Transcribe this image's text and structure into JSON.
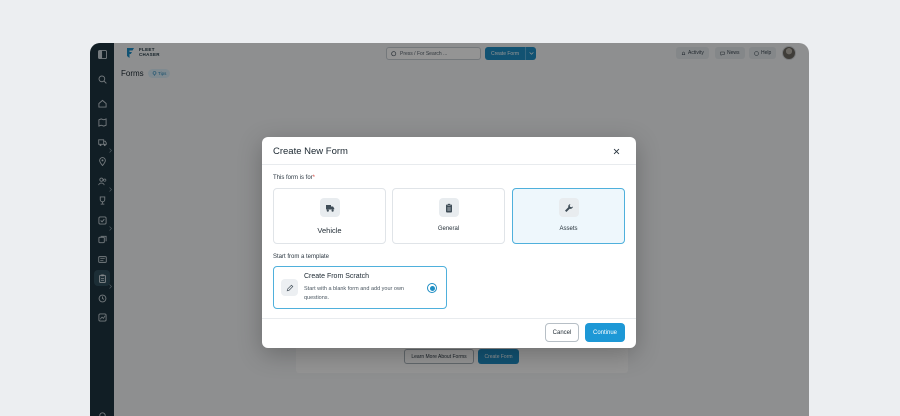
{
  "app": {
    "logo_line1": "FLEET",
    "logo_line2": "CHASER"
  },
  "topbar": {
    "search_placeholder": "Press / For Search ...",
    "create_button": "Create Form",
    "activity": "Activity",
    "news": "News",
    "help": "Help"
  },
  "page": {
    "title": "Forms",
    "tips": "Tips"
  },
  "background": {
    "learn_more": "Learn More About Forms",
    "create_form": "Create Form"
  },
  "sidebar": {
    "items": [
      "home-icon",
      "map-icon",
      "truck-icon",
      "location-pin-icon",
      "users-icon",
      "trophy-icon",
      "checklist-icon",
      "reports-icon",
      "id-card-icon",
      "forms-icon",
      "history-icon",
      "chart-icon"
    ],
    "active": "forms-icon"
  },
  "modal": {
    "title": "Create New Form",
    "for_label": "This form is for",
    "required_mark": "*",
    "options": [
      {
        "label": "Vehicle",
        "icon": "vehicle-icon",
        "selected": false
      },
      {
        "label": "General",
        "icon": "clipboard-icon",
        "selected": false
      },
      {
        "label": "Assets",
        "icon": "wrench-icon",
        "selected": true
      }
    ],
    "template_label": "Start from a template",
    "template": {
      "title": "Create From Scratch",
      "description": "Start with a blank form and add your own questions.",
      "icon": "pencil-icon",
      "selected": true
    },
    "cancel": "Cancel",
    "continue": "Continue"
  },
  "colors": {
    "primary": "#1d98d6",
    "sidebar": "#1e3440",
    "selected_border": "#4fb0dc",
    "required": "#d9433a"
  }
}
